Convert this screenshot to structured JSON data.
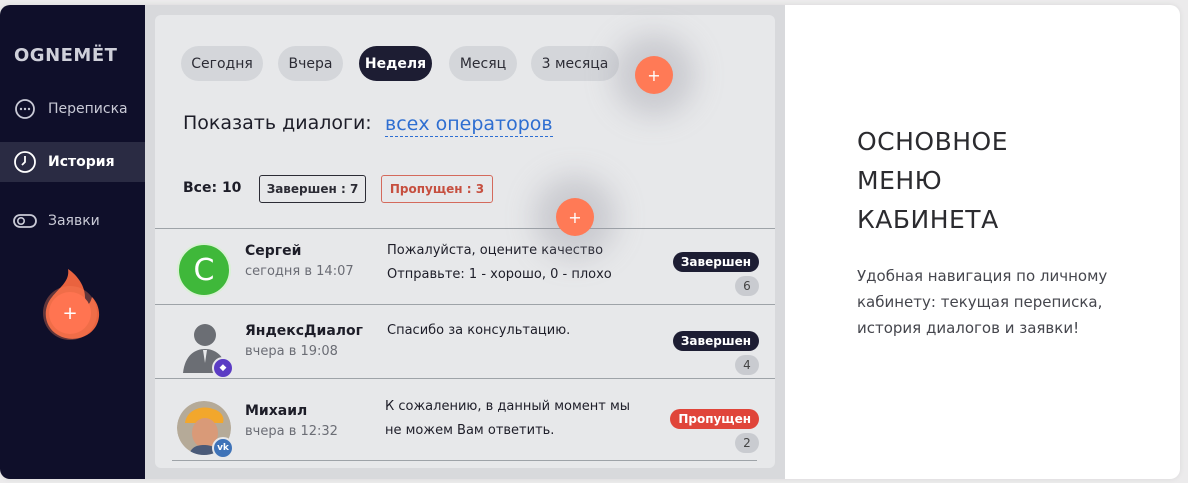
{
  "sidebar": {
    "logo": "OGNEMЁT",
    "items": [
      {
        "label": "Переписка",
        "icon": "chat-icon"
      },
      {
        "label": "История",
        "icon": "clock-icon",
        "active": true
      },
      {
        "label": "Заявки",
        "icon": "toggle-icon"
      }
    ],
    "plus": "+"
  },
  "filters": {
    "periods": [
      "Сегодня",
      "Вчера",
      "Неделя",
      "Месяц",
      "3 месяца"
    ],
    "active_period": "Неделя",
    "show_label": "Показать диалоги:",
    "show_link": "всех операторов",
    "count_all": "Все: 10",
    "count_done": "Завершен : 7",
    "count_missed": "Пропущен : 3"
  },
  "dialogs": [
    {
      "avatar_letter": "С",
      "name": "Сергей",
      "time": "сегодня в 14:07",
      "msg_line1": "Пожалуйста, оцените качество",
      "msg_line2": "Отправьте: 1 - хорошо, 0 - плохо",
      "status": "Завершен",
      "count": "6"
    },
    {
      "name": "ЯндексДиалог",
      "time": "вчера в 19:08",
      "msg_line1": "Спасибо за консультацию.",
      "msg_line2": "",
      "status": "Завершен",
      "count": "4"
    },
    {
      "name": "Михаил",
      "time": "вчера в 12:32",
      "msg_line1": "К сожалению, в данный момент мы",
      "msg_line2": "не можем Вам ответить.",
      "status": "Пропущен",
      "count": "2",
      "badge": "vk"
    }
  ],
  "hotspots": [
    "+",
    "+"
  ],
  "info": {
    "heading_line1": "ОСНОВНОЕ",
    "heading_line2": "МЕНЮ",
    "heading_line3": "КАБИНЕТА",
    "description": "Удобная навигация по личному кабинету: текущая переписка, история диалогов и заявки!"
  },
  "colors": {
    "sidebar_bg": "#0f0f2a",
    "accent": "#ff7451",
    "status_done": "#1d1d33",
    "status_missed": "#e0453a",
    "link": "#2e6ed1"
  }
}
